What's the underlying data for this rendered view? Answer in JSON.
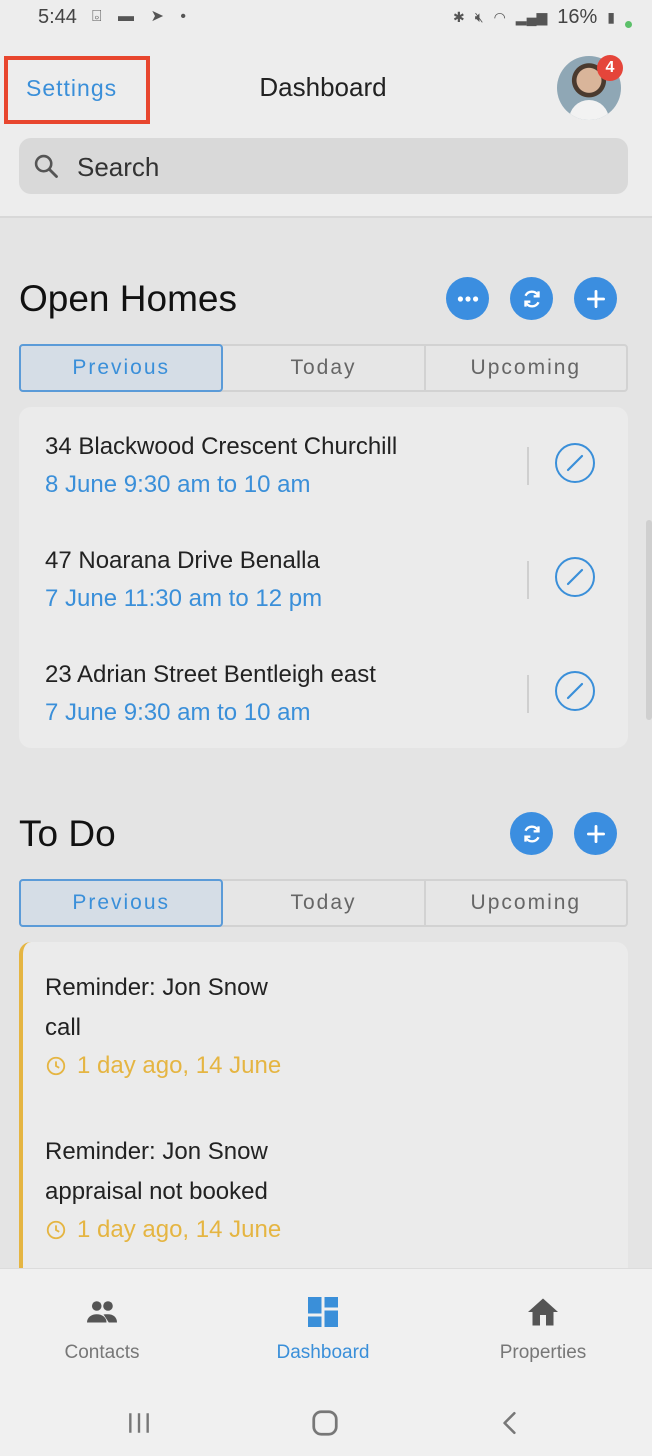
{
  "status_bar": {
    "time": "5:44",
    "left_icons": "⌻ ▬ ➤ •",
    "battery": "16%"
  },
  "header": {
    "settings_label": "Settings",
    "title": "Dashboard",
    "notification_count": "4",
    "search_placeholder": "Search"
  },
  "open_homes": {
    "title": "Open Homes",
    "tabs": [
      "Previous",
      "Today",
      "Upcoming"
    ],
    "active_tab": "Previous",
    "items": [
      {
        "address": "34 Blackwood Crescent Churchill",
        "time": "8 June 9:30 am to 10 am"
      },
      {
        "address": "47 Noarana Drive Benalla",
        "time": "7 June 11:30 am to 12 pm"
      },
      {
        "address": "23 Adrian Street Bentleigh east",
        "time": "7 June 9:30 am to 10 am"
      }
    ]
  },
  "todo": {
    "title": "To Do",
    "tabs": [
      "Previous",
      "Today",
      "Upcoming"
    ],
    "active_tab": "Previous",
    "items": [
      {
        "title": "Reminder: Jon Snow",
        "note": "call",
        "time": "1 day ago, 14 June"
      },
      {
        "title": "Reminder: Jon Snow",
        "note": "appraisal not booked",
        "time": "1 day ago, 14 June"
      }
    ]
  },
  "bottom_nav": [
    {
      "label": "Contacts",
      "icon": "people-icon"
    },
    {
      "label": "Dashboard",
      "icon": "dashboard-icon",
      "active": true
    },
    {
      "label": "Properties",
      "icon": "house-icon"
    }
  ],
  "colors": {
    "accent": "#3a8fd9",
    "todo_accent": "#e5b542",
    "highlight_box": "#e8462e",
    "badge": "#e5453a"
  }
}
